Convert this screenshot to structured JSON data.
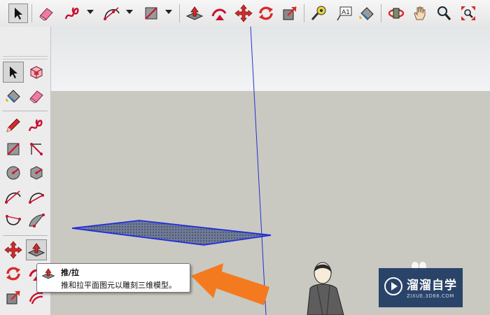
{
  "tooltip": {
    "title": "推/拉",
    "description": "推和拉平面图元以雕刻三维模型。"
  },
  "watermark": {
    "name": "溜溜自学",
    "url": "ZIXUE.3D66.COM"
  },
  "colors": {
    "accent_red": "#d92a2a",
    "axis_blue": "#2233cc",
    "face_fill": "#5f6c8a",
    "arrow_orange": "#f47a20",
    "watermark_bg": "#1f3a63"
  },
  "top_toolbar": [
    "select-tool",
    "eraser-tool",
    "freehand-tool",
    "arc-tool",
    "rectangle-tool",
    "push-pull-tool",
    "follow-me-tool",
    "move-tool",
    "rotate-tool",
    "scale-tool",
    "tape-measure-tool",
    "text-tool",
    "paint-bucket-tool",
    "orbit-tool",
    "pan-tool",
    "zoom-tool",
    "zoom-extents-tool"
  ],
  "left_toolbar": [
    "select-tool",
    "make-component-tool",
    "paint-bucket-tool",
    "eraser-tool",
    "pencil-tool",
    "freehand-tool",
    "rectangle-tool",
    "rotated-rectangle-tool",
    "circle-tool",
    "polygon-tool",
    "arc-tool",
    "pie-tool",
    "two-point-arc-tool",
    "three-point-arc-tool",
    "move-tool",
    "push-pull-tool",
    "rotate-tool",
    "follow-me-tool",
    "scale-tool",
    "offset-tool"
  ]
}
